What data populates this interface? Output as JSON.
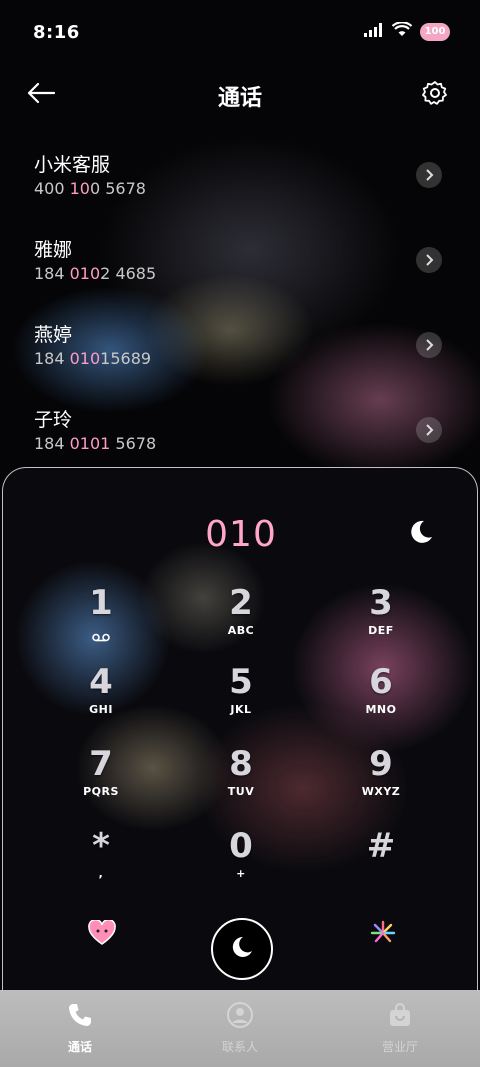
{
  "status": {
    "time": "8:16",
    "battery": "100"
  },
  "header": {
    "title": "通话"
  },
  "contacts": [
    {
      "name": "小米客服",
      "num_pre": "400 ",
      "num_hl": "10",
      "num_post": "0 5678"
    },
    {
      "name": "雅娜",
      "num_pre": "184 ",
      "num_hl": "010",
      "num_post": "2 4685"
    },
    {
      "name": "燕婷",
      "num_pre": "184 ",
      "num_hl": "010",
      "num_post": "15689"
    },
    {
      "name": "子玲",
      "num_pre": "184 ",
      "num_hl": "0101",
      "num_post": " 5678"
    }
  ],
  "dialer": {
    "number": "010",
    "keys": [
      {
        "digit": "1",
        "letters": ""
      },
      {
        "digit": "2",
        "letters": "ABC"
      },
      {
        "digit": "3",
        "letters": "DEF"
      },
      {
        "digit": "4",
        "letters": "GHI"
      },
      {
        "digit": "5",
        "letters": "JKL"
      },
      {
        "digit": "6",
        "letters": "MNO"
      },
      {
        "digit": "7",
        "letters": "PQRS"
      },
      {
        "digit": "8",
        "letters": "TUV"
      },
      {
        "digit": "9",
        "letters": "WXYZ"
      },
      {
        "digit": "*",
        "letters": ","
      },
      {
        "digit": "0",
        "letters": "+"
      },
      {
        "digit": "#",
        "letters": ""
      }
    ]
  },
  "nav": {
    "calls": "通话",
    "contacts": "联系人",
    "store": "营业厅"
  },
  "colors": {
    "accent_pink": "#ffa6c9",
    "nav_bg": "#b4b4b4"
  },
  "icons": [
    "back-arrow-icon",
    "gear-icon",
    "chevron-right-icon",
    "moon-star-icon",
    "voicemail-icon",
    "heart-mascot-icon",
    "firework-icon",
    "phone-icon",
    "person-icon",
    "store-bag-icon"
  ]
}
